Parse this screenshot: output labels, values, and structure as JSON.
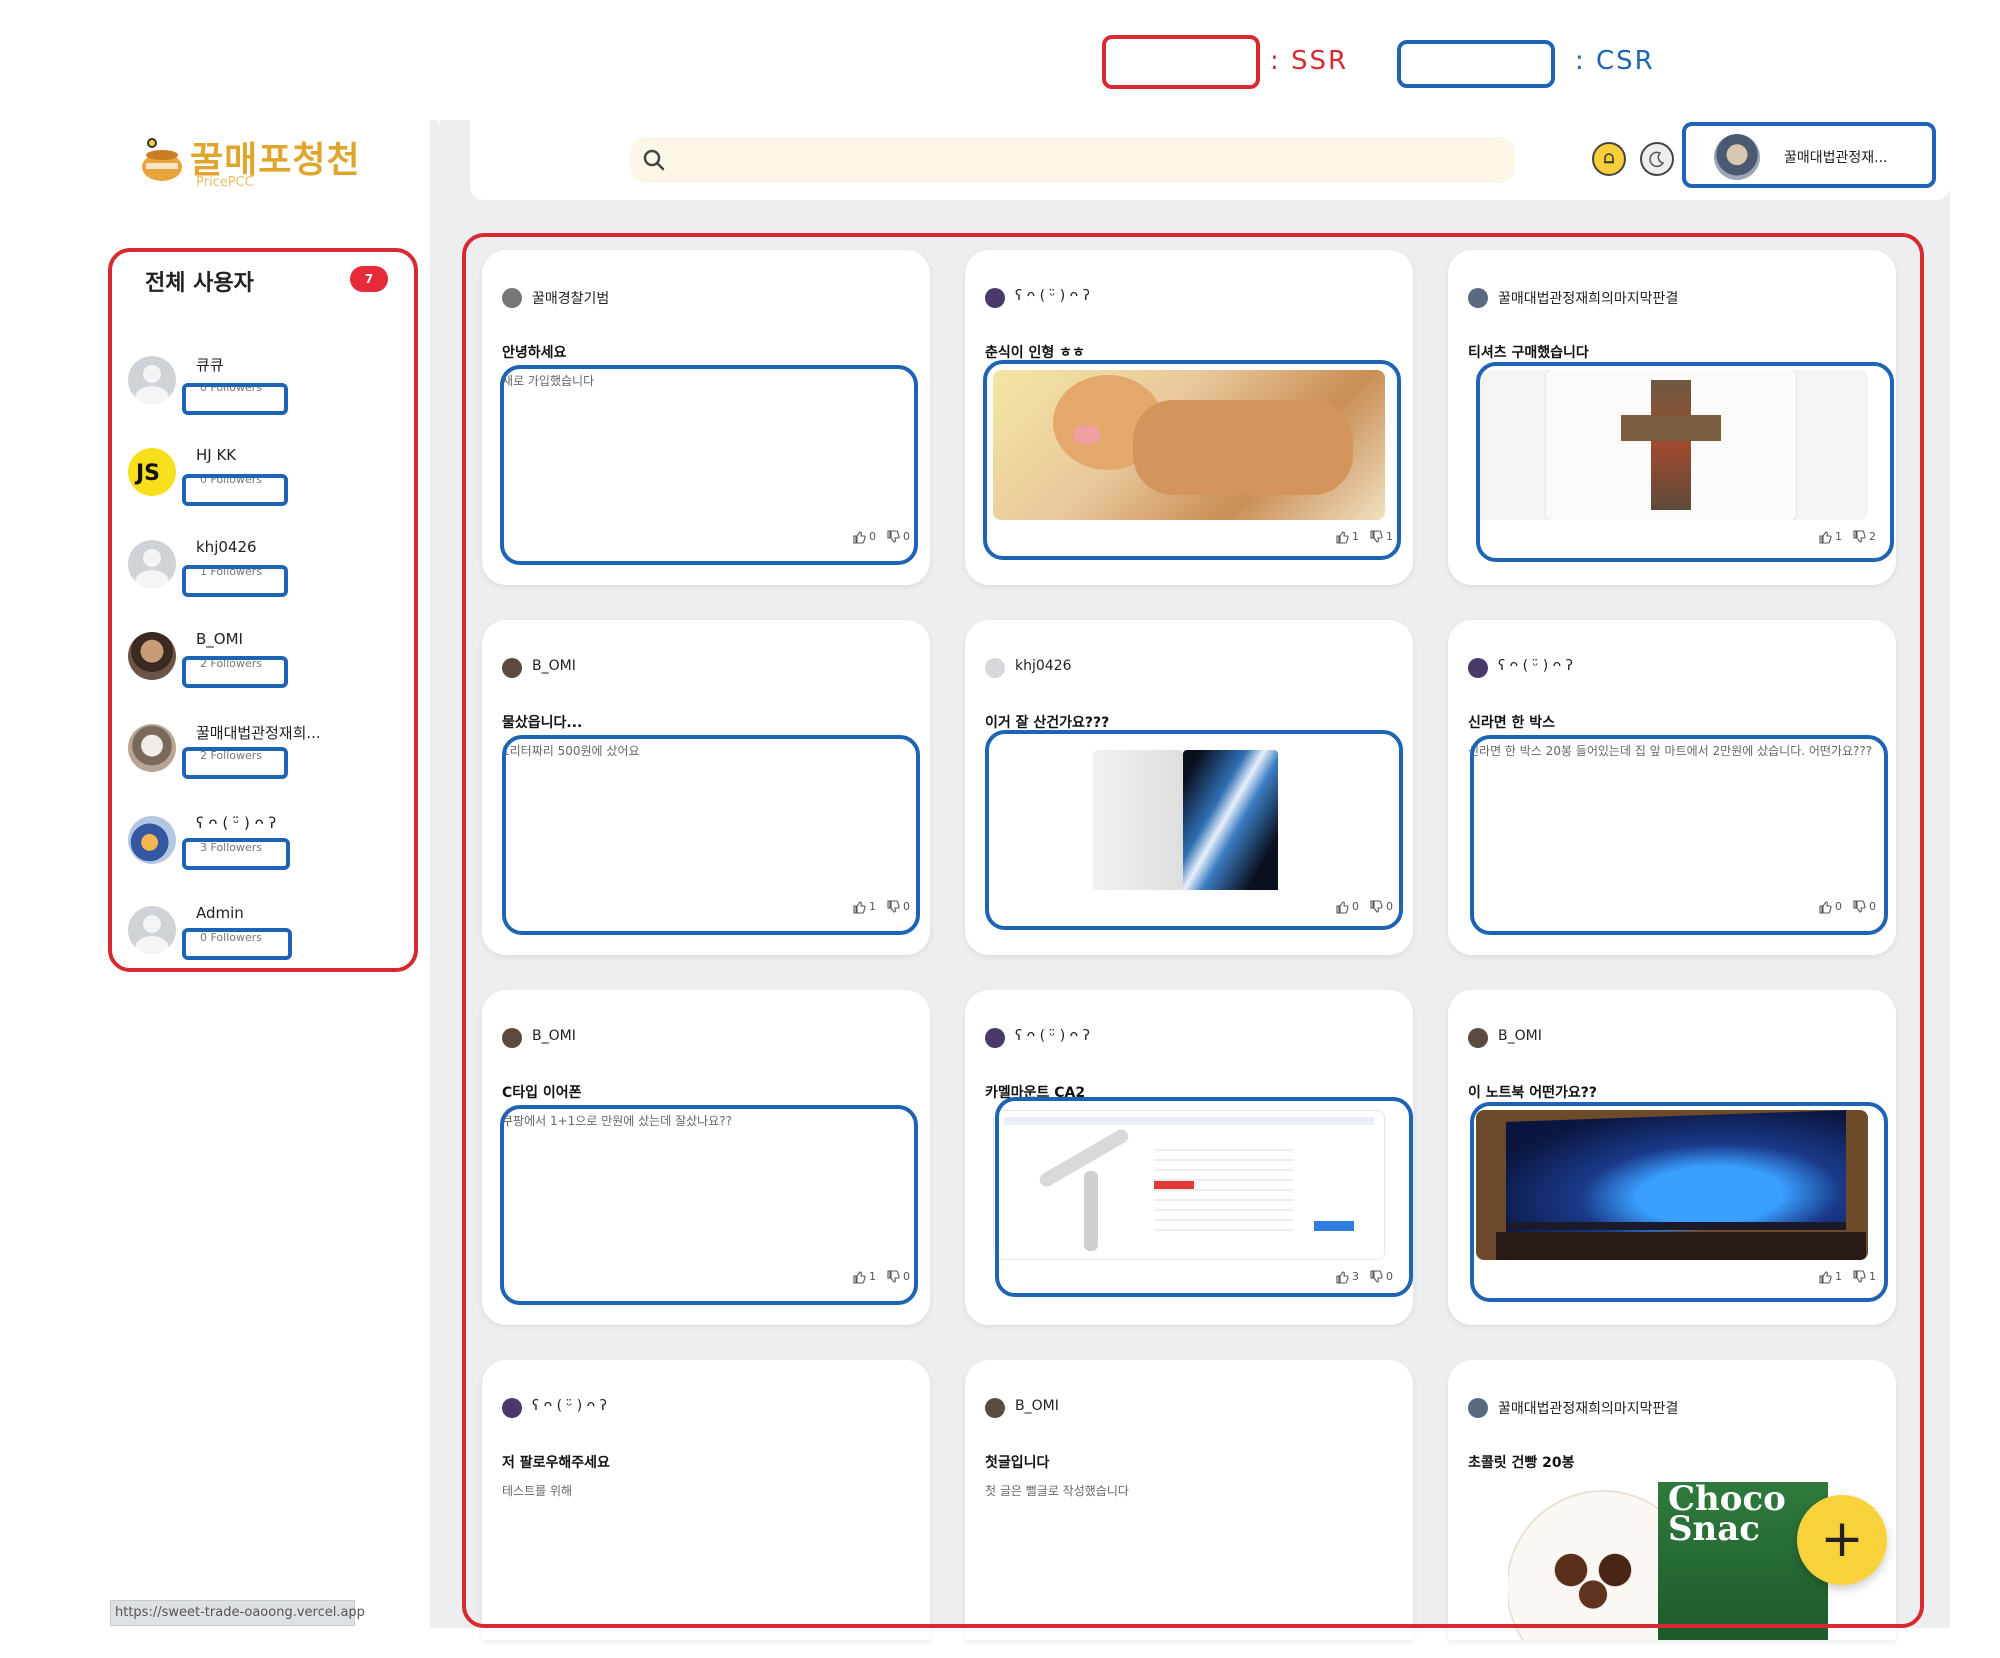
{
  "legend": {
    "ssr_label": ": SSR",
    "csr_label": ": CSR",
    "ssr_color": "#d62a30",
    "csr_color": "#1e63b4"
  },
  "logo": {
    "name": "꿀매포청천",
    "subtitle": "PricePCC",
    "icon": "honey-pot-icon"
  },
  "users_panel": {
    "title": "전체 사용자",
    "count": "7",
    "users": [
      {
        "name": "큐큐",
        "followers": "0 Followers",
        "avatar": "default"
      },
      {
        "name": "HJ KK",
        "followers": "0 Followers",
        "avatar": "js",
        "avatar_text": "JS"
      },
      {
        "name": "khj0426",
        "followers": "1 Followers",
        "avatar": "default"
      },
      {
        "name": "B_OMI",
        "followers": "2 Followers",
        "avatar": "photo1"
      },
      {
        "name": "꿀매대법관정재희...",
        "followers": "2 Followers",
        "avatar": "photo2"
      },
      {
        "name": "ʕ ᴖ ( ᵕ̈ ) ᴖ ʔ",
        "followers": "3 Followers",
        "avatar": "photo3"
      },
      {
        "name": "Admin",
        "followers": "0 Followers",
        "avatar": "default"
      }
    ]
  },
  "header": {
    "search_icon": "search-icon",
    "notification_icon": "bell-icon",
    "theme_icon": "moon-icon",
    "profile_name": "꿀매대법관정재..."
  },
  "posts": [
    {
      "author": "꿀매경찰기범",
      "title": "안녕하세요",
      "body": "새로 가입했습니다",
      "likes": "0",
      "dislikes": "0"
    },
    {
      "author": "ʕ ᴖ ( ᵕ̈ ) ᴖ ʔ",
      "title": "춘식이 인형 ㅎㅎ",
      "body": "",
      "likes": "1",
      "dislikes": "1"
    },
    {
      "author": "꿀매대법관정재희의마지막판결",
      "title": "티셔츠 구매했습니다",
      "body": "",
      "likes": "1",
      "dislikes": "2"
    },
    {
      "author": "B_OMI",
      "title": "물샀읍니다...",
      "body": "1리터짜리 500원에 샀어요",
      "likes": "1",
      "dislikes": "0"
    },
    {
      "author": "khj0426",
      "title": "이거 잘 산건가요???",
      "body": "",
      "likes": "0",
      "dislikes": "0"
    },
    {
      "author": "ʕ ᴖ ( ᵕ̈ ) ᴖ ʔ",
      "title": "신라면 한 박스",
      "body": "신라면 한 박스 20봉 들어있는데 집 앞 마트에서 2만원에 샀습니다. 어떤가요???",
      "likes": "0",
      "dislikes": "0"
    },
    {
      "author": "B_OMI",
      "title": "C타입 이어폰",
      "body": "쿠팡에서 1+1으로 만원에 샀는데 잘샀나요??",
      "likes": "1",
      "dislikes": "0"
    },
    {
      "author": "ʕ ᴖ ( ᵕ̈ ) ᴖ ʔ",
      "title": "카멜마운트 CA2",
      "body": "",
      "likes": "3",
      "dislikes": "0"
    },
    {
      "author": "B_OMI",
      "title": "이 노트북 어떤가요??",
      "body": "",
      "likes": "1",
      "dislikes": "1"
    },
    {
      "author": "ʕ ᴖ ( ᵕ̈ ) ᴖ ʔ",
      "title": "저 팔로우해주세요",
      "body": "테스트를 위해",
      "likes": "",
      "dislikes": ""
    },
    {
      "author": "B_OMI",
      "title": "첫글입니다",
      "body": "첫 글은 뻘글로 작성했습니다",
      "likes": "",
      "dislikes": ""
    },
    {
      "author": "꿀매대법관정재희의마지막판결",
      "title": "초콜릿 건빵 20봉",
      "body": "",
      "likes": "",
      "dislikes": ""
    }
  ],
  "media_text": {
    "choco_line1": "Choco",
    "choco_line2": "Snac"
  },
  "fab": {
    "label": "+"
  },
  "status_url": "https://sweet-trade-oaoong.vercel.app"
}
